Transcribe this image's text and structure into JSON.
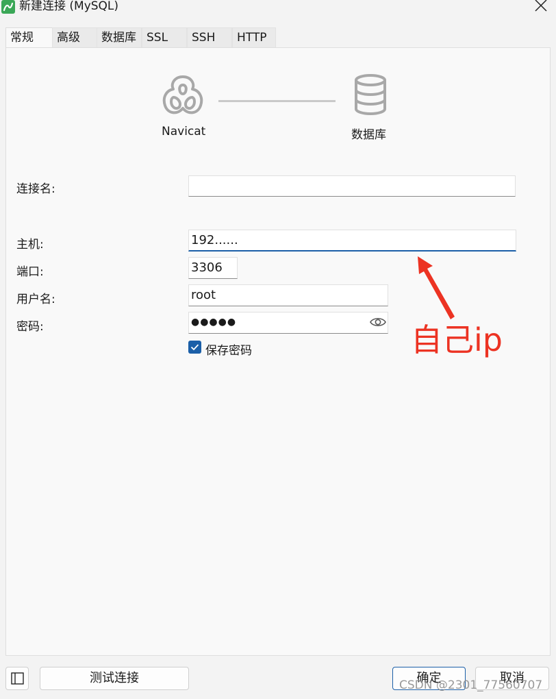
{
  "window": {
    "title": "新建连接 (MySQL)"
  },
  "tabs": [
    {
      "label": "常规",
      "active": true
    },
    {
      "label": "高级",
      "active": false
    },
    {
      "label": "数据库",
      "active": false
    },
    {
      "label": "SSL",
      "active": false
    },
    {
      "label": "SSH",
      "active": false
    },
    {
      "label": "HTTP",
      "active": false
    }
  ],
  "diagram": {
    "left_label": "Navicat",
    "right_label": "数据库",
    "left_icon": "navicat-logo-icon",
    "right_icon": "database-icon"
  },
  "form": {
    "connection_name_label": "连接名:",
    "connection_name_value": "",
    "host_label": "主机:",
    "host_value": "192......",
    "port_label": "端口:",
    "port_value": "3306",
    "username_label": "用户名:",
    "username_value": "root",
    "password_label": "密码:",
    "password_masked": "●●●●●",
    "save_password_label": "保存密码",
    "save_password_checked": true
  },
  "annotation": {
    "text": "自己ip",
    "color": "#ec3323"
  },
  "footer": {
    "test_connection": "测试连接",
    "ok": "确定",
    "cancel": "取消"
  },
  "watermark": "CSDN @2301_77560707",
  "colors": {
    "accent": "#1b5fa8",
    "annotation_red": "#ec3323"
  }
}
